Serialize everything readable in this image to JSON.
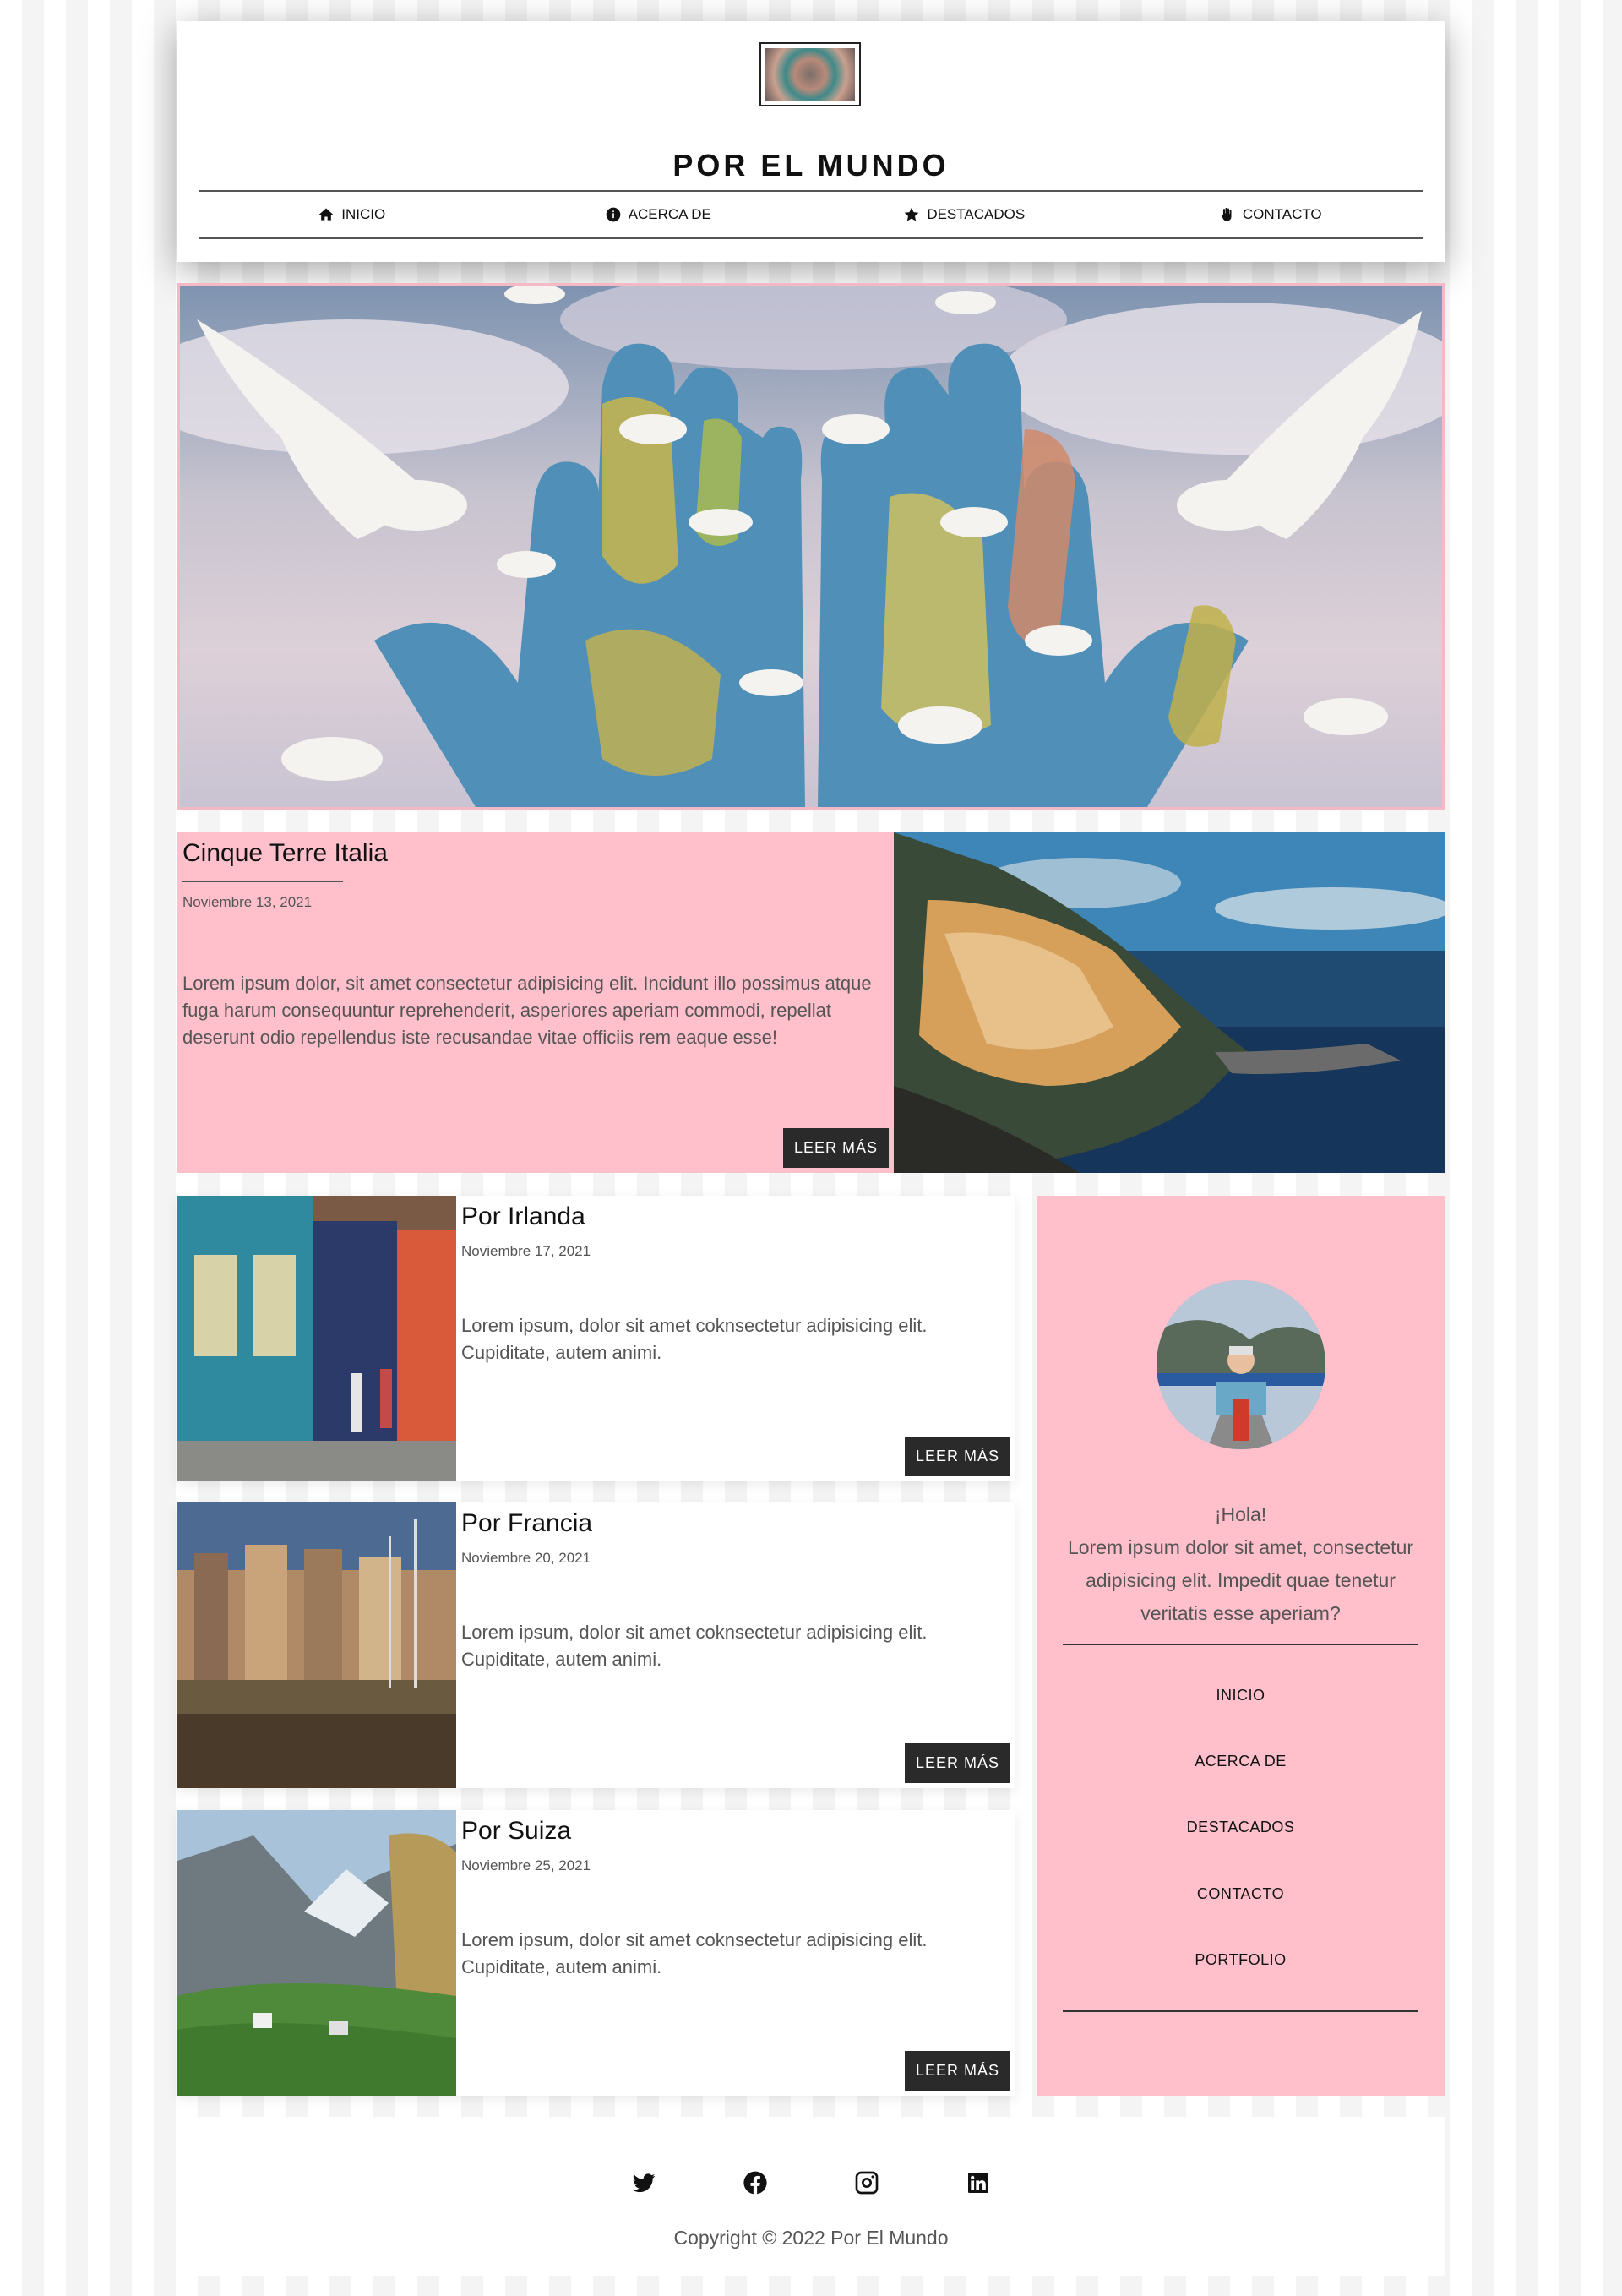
{
  "header": {
    "title": "POR EL MUNDO",
    "nav": [
      {
        "label": "INICIO",
        "icon": "home-icon"
      },
      {
        "label": "ACERCA DE",
        "icon": "info-icon"
      },
      {
        "label": "DESTACADOS",
        "icon": "star-icon"
      },
      {
        "label": "CONTACTO",
        "icon": "hand-icon"
      }
    ]
  },
  "featured": {
    "title": "Cinque Terre Italia",
    "date": "Noviembre 13, 2021",
    "excerpt": "Lorem ipsum dolor, sit amet consectetur adipisicing elit. Incidunt illo possimus atque fuga harum consequuntur reprehenderit, asperiores aperiam commodi, repellat deserunt odio repellendus iste recusandae vitae officiis rem eaque esse!",
    "button": "LEER MÁS"
  },
  "posts": [
    {
      "title": "Por Irlanda",
      "date": "Noviembre 17, 2021",
      "excerpt": "Lorem ipsum, dolor sit amet coknsectetur adipisicing elit. Cupiditate, autem animi.",
      "button": "LEER MÁS"
    },
    {
      "title": "Por Francia",
      "date": "Noviembre 20, 2021",
      "excerpt": "Lorem ipsum, dolor sit amet coknsectetur adipisicing elit. Cupiditate, autem animi.",
      "button": "LEER MÁS"
    },
    {
      "title": "Por Suiza",
      "date": "Noviembre 25, 2021",
      "excerpt": "Lorem ipsum, dolor sit amet coknsectetur adipisicing elit. Cupiditate, autem animi.",
      "button": "LEER MÁS"
    }
  ],
  "sidebar": {
    "greeting_title": "¡Hola!",
    "greeting_text": "Lorem ipsum dolor sit amet, consectetur adipisicing elit. Impedit quae tenetur veritatis esse aperiam?",
    "menu": [
      "INICIO",
      "ACERCA DE",
      "DESTACADOS",
      "CONTACTO",
      "PORTFOLIO"
    ]
  },
  "footer": {
    "social": [
      "twitter-icon",
      "facebook-icon",
      "instagram-icon",
      "linkedin-icon"
    ],
    "copyright": "Copyright © 2022 Por El Mundo"
  },
  "colors": {
    "accent_pink": "#ffc0cb",
    "button_dark": "#2a2a2a"
  }
}
